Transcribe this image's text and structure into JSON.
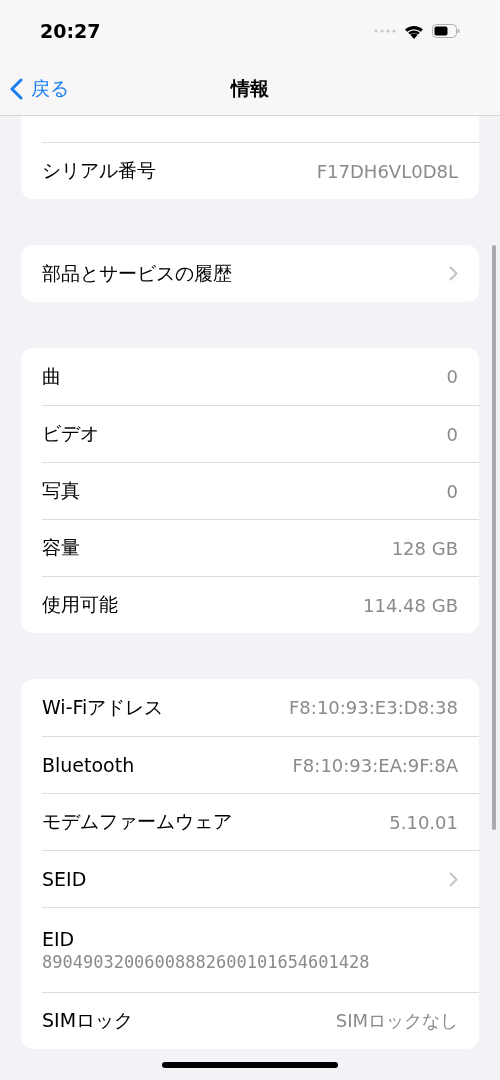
{
  "status_bar": {
    "time": "20:27"
  },
  "nav": {
    "back": "戻る",
    "title": "情報"
  },
  "groups": [
    {
      "cut_top": true,
      "rows": [
        {
          "kind": "value",
          "label": "シリアル番号",
          "value": "F17DH6VL0D8L"
        }
      ]
    },
    {
      "rows": [
        {
          "kind": "chevron",
          "label": "部品とサービスの履歴"
        }
      ]
    },
    {
      "rows": [
        {
          "kind": "value",
          "label": "曲",
          "value": "0"
        },
        {
          "kind": "value",
          "label": "ビデオ",
          "value": "0"
        },
        {
          "kind": "value",
          "label": "写真",
          "value": "0"
        },
        {
          "kind": "value",
          "label": "容量",
          "value": "128 GB"
        },
        {
          "kind": "value",
          "label": "使用可能",
          "value": "114.48 GB"
        }
      ]
    },
    {
      "rows": [
        {
          "kind": "value",
          "label": "Wi-Fiアドレス",
          "value": "F8:10:93:E3:D8:38"
        },
        {
          "kind": "value",
          "label": "Bluetooth",
          "value": "F8:10:93:EA:9F:8A"
        },
        {
          "kind": "value",
          "label": "モデムファームウェア",
          "value": "5.10.01"
        },
        {
          "kind": "chevron",
          "label": "SEID"
        },
        {
          "kind": "stacked",
          "label": "EID",
          "value": "89049032006008882600101654601428"
        },
        {
          "kind": "value",
          "label": "SIMロック",
          "value": "SIMロックなし"
        }
      ]
    }
  ]
}
